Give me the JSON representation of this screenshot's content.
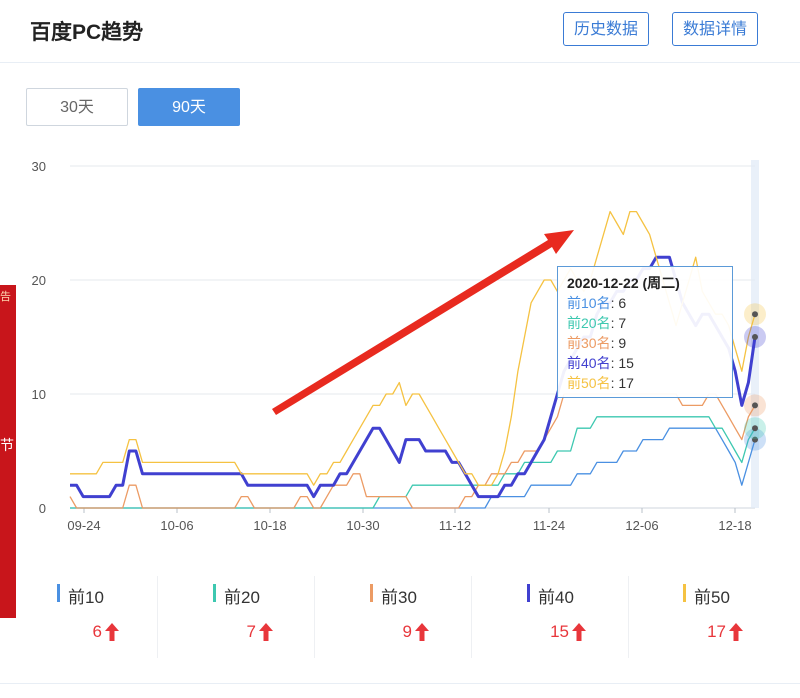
{
  "header": {
    "title": "百度PC趋势",
    "history_label": "历史数据",
    "detail_label": "数据详情"
  },
  "tabs": [
    {
      "label": "30天",
      "active": false
    },
    {
      "label": "90天",
      "active": true
    }
  ],
  "ad": {
    "text_top": "告",
    "text_mid": "节"
  },
  "colors": {
    "top10": "#4a90e2",
    "top20": "#3dc8b0",
    "top30": "#ec9b64",
    "top40": "#4040d0",
    "top50": "#f5c242",
    "accent": "#4a90e2",
    "up": "#e8363b"
  },
  "tooltip": {
    "date": "2020-12-22 (周二)",
    "rows": [
      {
        "label": "前10名",
        "value": "6",
        "color": "#4a90e2"
      },
      {
        "label": "前20名",
        "value": "7",
        "color": "#3dc8b0"
      },
      {
        "label": "前30名",
        "value": "9",
        "color": "#ec9b64"
      },
      {
        "label": "前40名",
        "value": "15",
        "color": "#4040d0"
      },
      {
        "label": "前50名",
        "value": "17",
        "color": "#f5c242"
      }
    ]
  },
  "legend": [
    {
      "name": "前10",
      "value": "6",
      "color": "#4a90e2"
    },
    {
      "name": "前20",
      "value": "7",
      "color": "#3dc8b0"
    },
    {
      "name": "前30",
      "value": "9",
      "color": "#ec9b64"
    },
    {
      "name": "前40",
      "value": "15",
      "color": "#4040d0"
    },
    {
      "name": "前50",
      "value": "17",
      "color": "#f5c242"
    }
  ],
  "chart_data": {
    "type": "line",
    "x_ticks": [
      "09-24",
      "10-06",
      "10-18",
      "10-30",
      "11-12",
      "11-24",
      "12-06",
      "12-18"
    ],
    "ylim": [
      0,
      30
    ],
    "y_ticks": [
      0,
      10,
      20,
      30
    ],
    "grid": true,
    "series": [
      {
        "name": "前10",
        "color": "#4a90e2",
        "values": [
          0,
          0,
          0,
          0,
          0,
          0,
          0,
          0,
          0,
          0,
          0,
          0,
          0,
          0,
          0,
          0,
          0,
          0,
          0,
          0,
          0,
          0,
          0,
          0,
          0,
          0,
          0,
          0,
          0,
          0,
          0,
          0,
          0,
          0,
          0,
          0,
          0,
          0,
          0,
          0,
          0,
          0,
          0,
          0,
          0,
          0,
          0,
          0,
          0,
          0,
          0,
          0,
          0,
          0,
          0,
          0,
          0,
          0,
          0,
          0,
          0,
          0,
          0,
          0,
          1,
          1,
          1,
          1,
          1,
          1,
          2,
          2,
          2,
          2,
          2,
          2,
          2,
          3,
          3,
          3,
          4,
          4,
          4,
          4,
          5,
          5,
          5,
          6,
          6,
          6,
          6,
          7,
          7,
          7,
          7,
          7,
          7,
          7,
          7,
          6,
          5,
          4,
          2,
          4,
          6
        ]
      },
      {
        "name": "前20",
        "color": "#3dc8b0",
        "values": [
          0,
          0,
          0,
          0,
          0,
          0,
          0,
          0,
          0,
          0,
          0,
          0,
          0,
          0,
          0,
          0,
          0,
          0,
          0,
          0,
          0,
          0,
          0,
          0,
          0,
          0,
          0,
          0,
          0,
          0,
          0,
          0,
          0,
          0,
          0,
          0,
          0,
          0,
          0,
          0,
          0,
          0,
          0,
          0,
          0,
          0,
          0,
          1,
          1,
          1,
          1,
          1,
          2,
          2,
          2,
          2,
          2,
          2,
          2,
          2,
          2,
          2,
          2,
          2,
          2,
          2,
          3,
          3,
          3,
          4,
          4,
          4,
          4,
          4,
          5,
          5,
          5,
          7,
          7,
          7,
          8,
          8,
          8,
          8,
          8,
          8,
          8,
          8,
          8,
          8,
          8,
          8,
          8,
          8,
          8,
          8,
          8,
          8,
          7,
          7,
          6,
          5,
          4,
          6,
          7
        ]
      },
      {
        "name": "前30",
        "color": "#ec9b64",
        "values": [
          1,
          0,
          0,
          0,
          0,
          0,
          0,
          0,
          0,
          2,
          2,
          0,
          0,
          0,
          0,
          0,
          0,
          0,
          0,
          0,
          0,
          0,
          0,
          0,
          0,
          0,
          1,
          1,
          0,
          0,
          0,
          0,
          0,
          0,
          0,
          1,
          1,
          0,
          0,
          1,
          2,
          2,
          2,
          3,
          3,
          1,
          1,
          1,
          1,
          1,
          1,
          1,
          0,
          0,
          0,
          0,
          0,
          0,
          0,
          0,
          1,
          1,
          2,
          2,
          3,
          3,
          3,
          4,
          4,
          5,
          5,
          5,
          6,
          7,
          8,
          10,
          10,
          10,
          10,
          10,
          10,
          10,
          10,
          10,
          10,
          10,
          10,
          10,
          10,
          10,
          10,
          10,
          10,
          9,
          9,
          9,
          9,
          10,
          10,
          9,
          8,
          7,
          6,
          8,
          9
        ]
      },
      {
        "name": "前40",
        "color": "#4040d0",
        "values": [
          2,
          2,
          1,
          1,
          1,
          1,
          1,
          2,
          2,
          5,
          5,
          3,
          3,
          3,
          3,
          3,
          3,
          3,
          3,
          3,
          3,
          3,
          3,
          3,
          3,
          3,
          3,
          2,
          2,
          2,
          2,
          2,
          2,
          2,
          2,
          2,
          2,
          1,
          2,
          2,
          2,
          3,
          3,
          4,
          5,
          6,
          7,
          7,
          6,
          5,
          4,
          6,
          6,
          6,
          5,
          5,
          5,
          5,
          4,
          4,
          3,
          2,
          1,
          1,
          1,
          1,
          2,
          2,
          3,
          3,
          4,
          5,
          6,
          8,
          10,
          12,
          13,
          14,
          15,
          15,
          17,
          18,
          18,
          19,
          19,
          20,
          20,
          21,
          21,
          22,
          22,
          22,
          20,
          18,
          17,
          16,
          17,
          17,
          16,
          15,
          14,
          12,
          9,
          11,
          15
        ]
      },
      {
        "name": "前50",
        "color": "#f5c242",
        "values": [
          3,
          3,
          3,
          3,
          3,
          4,
          4,
          4,
          4,
          6,
          6,
          4,
          4,
          4,
          4,
          4,
          4,
          4,
          4,
          4,
          4,
          4,
          4,
          4,
          4,
          4,
          3,
          3,
          3,
          3,
          3,
          3,
          3,
          3,
          3,
          3,
          3,
          2,
          3,
          3,
          4,
          4,
          5,
          6,
          7,
          8,
          9,
          9,
          10,
          10,
          11,
          9,
          10,
          10,
          9,
          8,
          7,
          6,
          5,
          4,
          3,
          3,
          2,
          2,
          2,
          3,
          5,
          8,
          12,
          15,
          18,
          19,
          20,
          20,
          19,
          20,
          21,
          20,
          19,
          20,
          22,
          24,
          26,
          25,
          24,
          26,
          26,
          25,
          24,
          22,
          20,
          18,
          16,
          18,
          20,
          22,
          19,
          18,
          17,
          17,
          16,
          14,
          12,
          15,
          17
        ]
      }
    ]
  }
}
